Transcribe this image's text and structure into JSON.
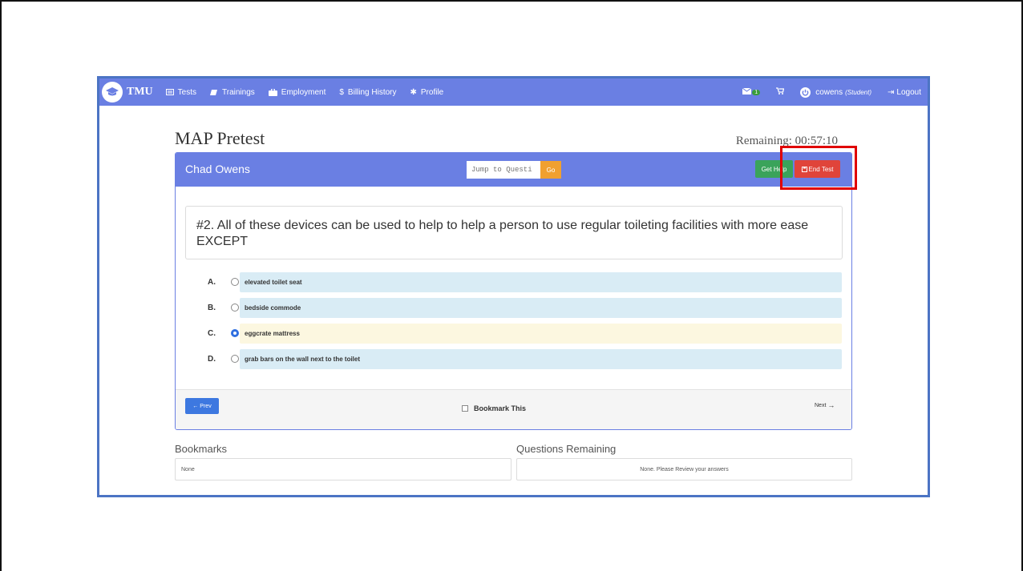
{
  "app": {
    "brand": "TMU",
    "nav": [
      {
        "label": "Tests",
        "icon": "list-icon"
      },
      {
        "label": "Trainings",
        "icon": "book-icon"
      },
      {
        "label": "Employment",
        "icon": "briefcase-icon"
      },
      {
        "label": "Billing History",
        "icon": "dollar-icon"
      },
      {
        "label": "Profile",
        "icon": "gear-icon"
      }
    ],
    "messages_badge": "1",
    "user": "cowens",
    "role": "(Student)",
    "logout_label": "Logout"
  },
  "test": {
    "title": "MAP Pretest",
    "remaining": "Remaining: 00:57:10",
    "student_name": "Chad Owens",
    "jump_placeholder": "Jump to Questi",
    "go_label": "Go",
    "help_label": "Get Help",
    "end_label": "End Test",
    "question": "#2. All of these devices can be used to help to help a person to use regular toileting facilities with more ease EXCEPT",
    "options": [
      {
        "letter": "A.",
        "text": "elevated toilet seat",
        "selected": false
      },
      {
        "letter": "B.",
        "text": "bedside commode",
        "selected": false
      },
      {
        "letter": "C.",
        "text": "eggcrate mattress",
        "selected": true
      },
      {
        "letter": "D.",
        "text": "grab bars on the wall next to the toilet",
        "selected": false
      }
    ],
    "prev_label": "Prev",
    "bookmark_label": "Bookmark This",
    "next_label": "Next"
  },
  "bookmarks": {
    "title": "Bookmarks",
    "value": "None"
  },
  "remaining_questions": {
    "title": "Questions Remaining",
    "value": "None. Please Review your answers"
  },
  "colors": {
    "navbar": "#6a7fe3",
    "end_button": "#e0443a",
    "help_button": "#3aa35a",
    "go_button": "#f0a030",
    "highlight": "#e00000"
  }
}
